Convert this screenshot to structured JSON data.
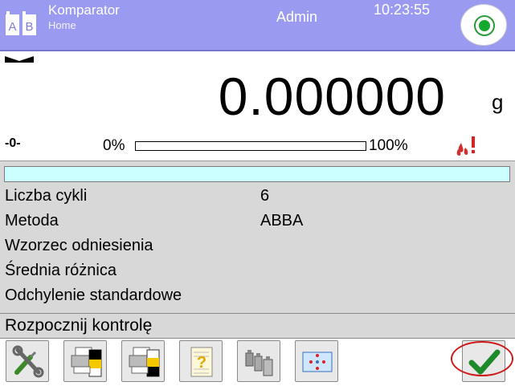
{
  "header": {
    "app_icon_letters": [
      "A",
      "B"
    ],
    "title": "Komparator",
    "subtitle": "Home",
    "user": "Admin",
    "time": "10:23:55",
    "status_button_icon": "green-dot-icon"
  },
  "weighing": {
    "value": "0.000000",
    "unit": "g",
    "zero_marker": "-0-",
    "bar_min_label": "0%",
    "bar_max_label": "100%",
    "load_fraction": 0,
    "stability_icon": "stable-marker-icon",
    "level_icon": "drops-warning-icon"
  },
  "info": {
    "progress_fraction": 0,
    "rows": [
      {
        "label": "Liczba cykli",
        "value": "6"
      },
      {
        "label": "Metoda",
        "value": "ABBA"
      },
      {
        "label": "Wzorzec odniesienia",
        "value": ""
      },
      {
        "label": "Średnia różnica",
        "value": ""
      },
      {
        "label": "Odchylenie standardowe",
        "value": ""
      }
    ]
  },
  "status_message": "Rozpocznij kontrolę",
  "toolbar": {
    "buttons": [
      {
        "icon": "settings-tools-icon"
      },
      {
        "icon": "printer-header-icon"
      },
      {
        "icon": "printer-footer-icon"
      },
      {
        "icon": "report-icon"
      },
      {
        "icon": "weights-icon"
      },
      {
        "icon": "pattern-icon"
      },
      {
        "icon": "confirm-check-icon"
      }
    ]
  },
  "colors": {
    "header_bg": "#9a9af0",
    "panel_bg": "#d8d8d8",
    "progress_strip": "#ccffff",
    "confirm_green": "#1e8a2a",
    "highlight_red": "#cc1a1a"
  }
}
